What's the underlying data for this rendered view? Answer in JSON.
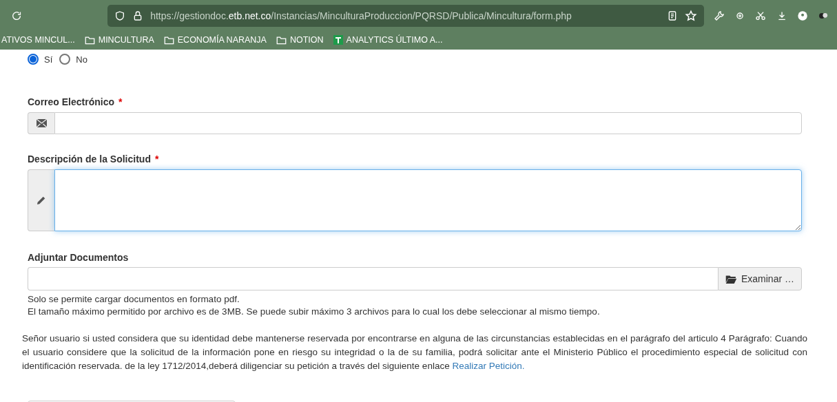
{
  "browser": {
    "url": "https://gestiondoc.**etb.net.co**/Instancias/MinculturaProduccion/PQRSD/Publica/Mincultura/form.php",
    "bookmarks": [
      {
        "label": "ATIVOS MINCUL...",
        "kind": "cut"
      },
      {
        "label": "MINCULTURA",
        "kind": "folder"
      },
      {
        "label": "ECONOMÍA NARANJA",
        "kind": "folder"
      },
      {
        "label": "NOTION",
        "kind": "folder"
      },
      {
        "label": "ANALYTICS ÚLTIMO A...",
        "kind": "site"
      }
    ]
  },
  "radios": [
    {
      "label": "Sí",
      "selected": true
    },
    {
      "label": "No",
      "selected": false
    }
  ],
  "email": {
    "label": "Correo Electrónico",
    "required_mark": "*"
  },
  "description": {
    "label": "Descripción de la Solicitud",
    "required_mark": "*",
    "focused": true
  },
  "attachments": {
    "label": "Adjuntar Documentos",
    "button": "Examinar …",
    "help": [
      "Solo se permite cargar documentos en formato pdf.",
      "El tamaño máximo permitido por archivo es de 3MB. Se puede subir máximo 3 archivos para lo cual los debe seleccionar al mismo tiempo."
    ]
  },
  "notice": {
    "text": "Señor usuario si usted considera que su identidad debe mantenerse reservada por encontrarse en alguna de las circunstancias establecidas en el parágrafo del articulo 4 Parágrafo: Cuando el usuario considere que la solicitud de la información pone en riesgo su integridad o la de su familia, podrá solicitar ante el Ministerio Público el procedimiento especial de solicitud con identificación reservada. de la ley 1712/2014,deberá diligenciar su petición a través del siguiente enlace",
    "link": "Realizar Petición."
  }
}
